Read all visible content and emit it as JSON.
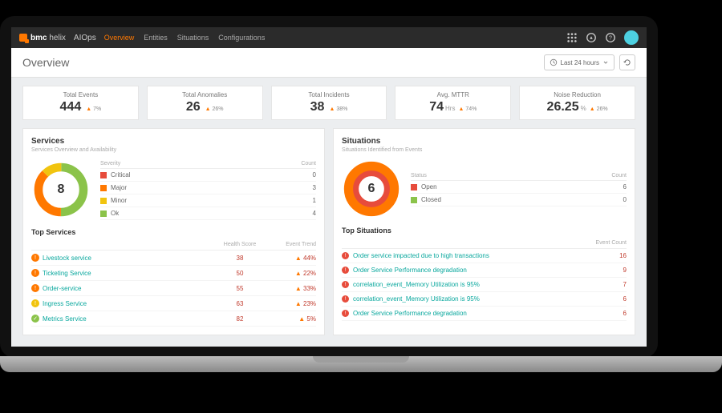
{
  "brand": {
    "part1": "bmc",
    "part2": "helix",
    "app": "AIOps"
  },
  "nav": {
    "tabs": [
      "Overview",
      "Entities",
      "Situations",
      "Configurations"
    ],
    "active": 0
  },
  "page": {
    "title": "Overview",
    "time_range": "Last 24 hours"
  },
  "kpis": [
    {
      "label": "Total Events",
      "value": "444",
      "unit": "",
      "delta": "7%"
    },
    {
      "label": "Total Anomalies",
      "value": "26",
      "unit": "",
      "delta": "26%"
    },
    {
      "label": "Total Incidents",
      "value": "38",
      "unit": "",
      "delta": "38%"
    },
    {
      "label": "Avg. MTTR",
      "value": "74",
      "unit": "Hrs",
      "delta": "74%"
    },
    {
      "label": "Noise Reduction",
      "value": "26.25",
      "unit": "%",
      "delta": "26%"
    }
  ],
  "services": {
    "title": "Services",
    "subtitle": "Services Overview and Availability",
    "center": "8",
    "legend_headers": [
      "Severity",
      "Count"
    ],
    "legend": [
      {
        "color": "#e74c3c",
        "label": "Critical",
        "count": "0"
      },
      {
        "color": "#ff7800",
        "label": "Major",
        "count": "3"
      },
      {
        "color": "#f1c40f",
        "label": "Minor",
        "count": "1"
      },
      {
        "color": "#8bc34a",
        "label": "Ok",
        "count": "4"
      }
    ],
    "top_title": "Top Services",
    "top_headers": [
      "",
      "Health Score",
      "Event Trend"
    ],
    "top": [
      {
        "icon_color": "#ff7800",
        "name": "Livestock service",
        "score": "38",
        "trend": "44%"
      },
      {
        "icon_color": "#ff7800",
        "name": "Ticketing Service",
        "score": "50",
        "trend": "22%"
      },
      {
        "icon_color": "#ff7800",
        "name": "Order-service",
        "score": "55",
        "trend": "33%"
      },
      {
        "icon_color": "#f1c40f",
        "name": "Ingress Service",
        "score": "63",
        "trend": "23%"
      },
      {
        "icon_color": "#8bc34a",
        "name": "Metrics Service",
        "score": "82",
        "trend": "5%"
      }
    ]
  },
  "situations": {
    "title": "Situations",
    "subtitle": "Situations Identified from Events",
    "center": "6",
    "legend_headers": [
      "Status",
      "Count"
    ],
    "legend": [
      {
        "color": "#e74c3c",
        "label": "Open",
        "count": "6"
      },
      {
        "color": "#8bc34a",
        "label": "Closed",
        "count": "0"
      }
    ],
    "top_title": "Top Situations",
    "top_headers": [
      "",
      "Event Count"
    ],
    "top": [
      {
        "name": "Order service impacted due to high transactions",
        "count": "16"
      },
      {
        "name": "Order Service Performance degradation",
        "count": "9"
      },
      {
        "name": "correlation_event_Memory Utilization is 95%",
        "count": "7"
      },
      {
        "name": "correlation_event_Memory Utilization is 95%",
        "count": "6"
      },
      {
        "name": "Order Service Performance degradation",
        "count": "6"
      }
    ]
  }
}
